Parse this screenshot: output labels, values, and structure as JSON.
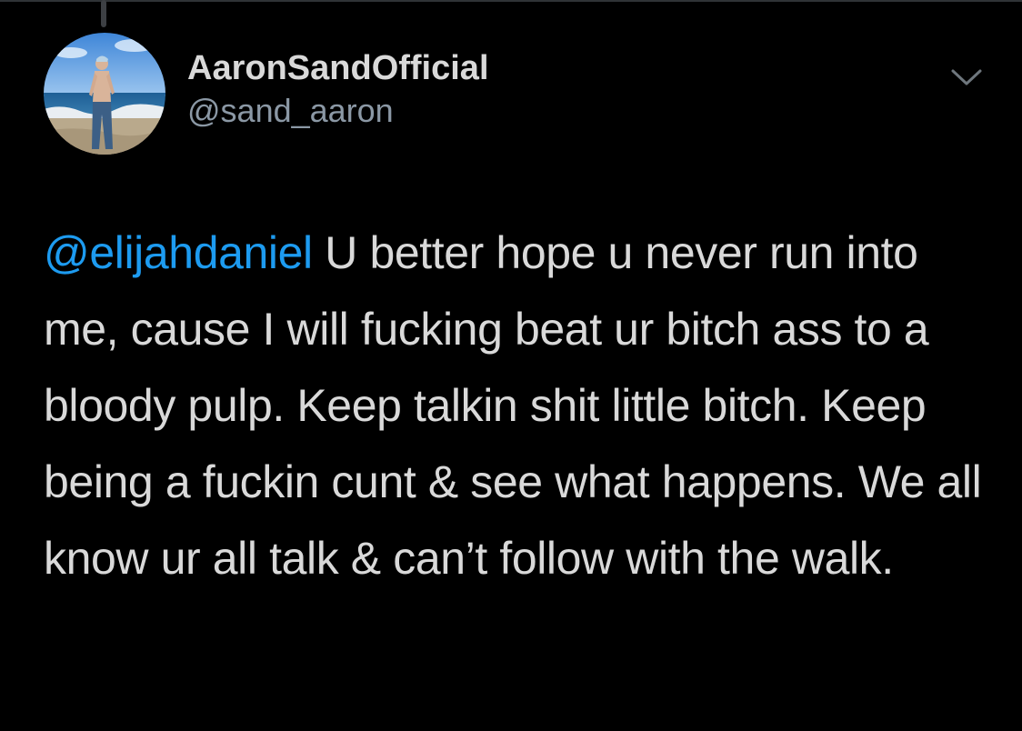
{
  "tweet": {
    "author": {
      "display_name": "AaronSandOfficial",
      "handle": "@sand_aaron",
      "avatar_icon": "profile-photo-beach"
    },
    "menu_icon": "chevron-down-icon",
    "mention": "@elijahdaniel",
    "body": "U better hope u never run into me, cause I will fucking beat ur bitch ass to a bloody pulp. Keep talkin shit little bitch. Keep being a fuckin cunt & see what happens. We all know ur all talk & can’t follow with the walk."
  },
  "colors": {
    "background": "#000000",
    "text": "#d9d9d9",
    "secondary_text": "#8b98a5",
    "mention": "#1d9bf0"
  }
}
